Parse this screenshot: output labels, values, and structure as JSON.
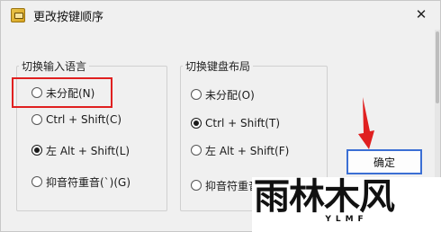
{
  "window": {
    "title": "更改按键顺序",
    "close_glyph": "✕"
  },
  "left_group": {
    "legend": "切换输入语言",
    "options": [
      {
        "label": "未分配(N)",
        "checked": false
      },
      {
        "label": "Ctrl + Shift(C)",
        "checked": false
      },
      {
        "label": "左 Alt + Shift(L)",
        "checked": true
      },
      {
        "label": "抑音符重音(`)(G)",
        "checked": false
      }
    ]
  },
  "right_group": {
    "legend": "切换键盘布局",
    "options": [
      {
        "label": "未分配(O)",
        "checked": false
      },
      {
        "label": "Ctrl + Shift(T)",
        "checked": true
      },
      {
        "label": "左 Alt + Shift(F)",
        "checked": false
      },
      {
        "label": "抑音符重音(`)(R)",
        "checked": false
      }
    ]
  },
  "buttons": {
    "ok_label": "确定"
  },
  "annotations": {
    "highlight_color": "#e02020",
    "arrow_color": "#e02020"
  },
  "watermark": {
    "main": "雨林木风",
    "sub": "YLMF"
  }
}
